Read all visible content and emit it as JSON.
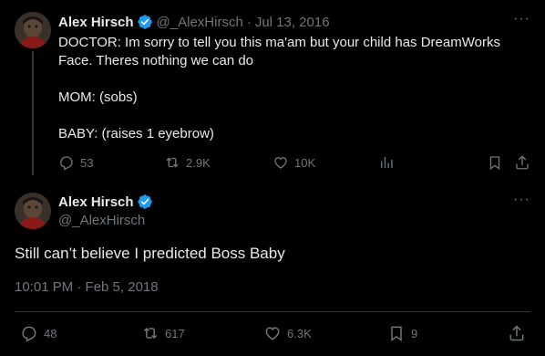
{
  "reply_tweet": {
    "author_name": "Alex Hirsch",
    "handle": "@_AlexHirsch",
    "separator": "·",
    "date": "Jul 13, 2016",
    "text": "DOCTOR: Im sorry to tell you this ma'am but your child has DreamWorks Face. Theres nothing we can do\n\nMOM: (sobs)\n\nBABY: (raises 1 eyebrow)",
    "more": "···",
    "actions": {
      "replies": "53",
      "reposts": "2.9K",
      "likes": "10K"
    }
  },
  "main_tweet": {
    "author_name": "Alex Hirsch",
    "handle": "@_AlexHirsch",
    "more": "···",
    "text": "Still can’t believe I predicted Boss Baby",
    "timestamp": "10:01 PM · Feb 5, 2018",
    "actions": {
      "replies": "48",
      "reposts": "617",
      "likes": "6.3K",
      "bookmarks": "9"
    }
  },
  "colors": {
    "background": "#000000",
    "text": "#e7e9ea",
    "muted": "#71767b",
    "verified": "#1d9bf0",
    "divider": "#2f3336"
  }
}
